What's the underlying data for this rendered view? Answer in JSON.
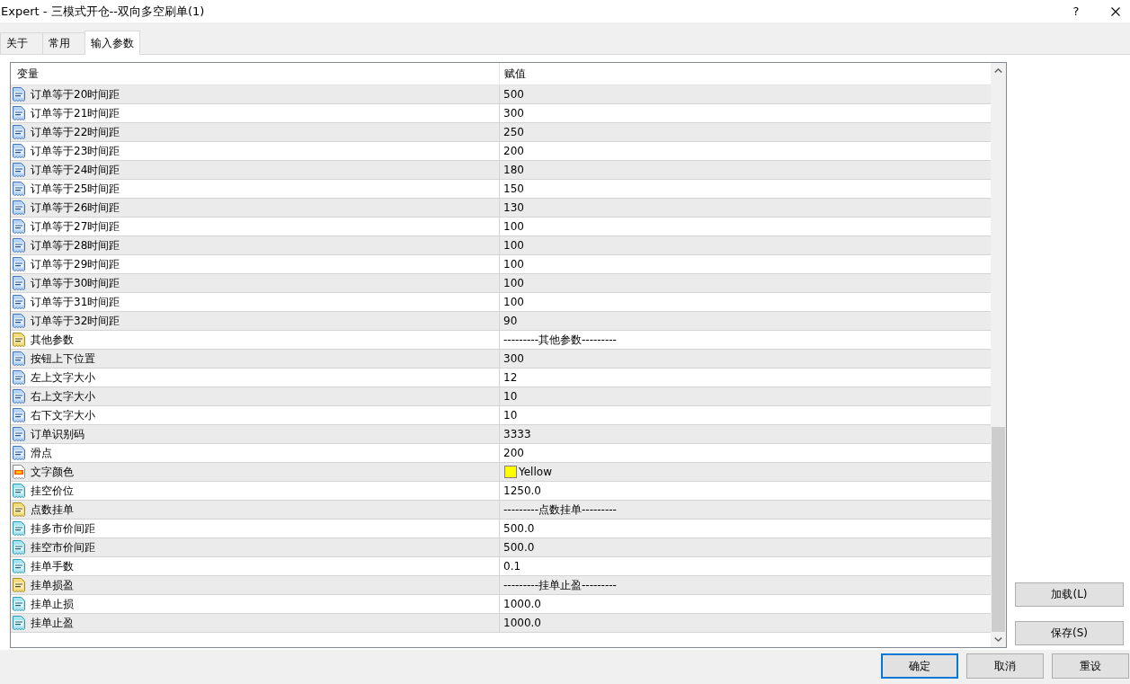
{
  "window": {
    "title": "Expert - 三模式开仓--双向多空刷单(1)",
    "help": "?"
  },
  "tabs": [
    {
      "label": "关于",
      "selected": false
    },
    {
      "label": "常用",
      "selected": false
    },
    {
      "label": "输入参数",
      "selected": true
    }
  ],
  "table": {
    "columns": [
      "变量",
      "赋值"
    ],
    "rows": [
      {
        "kind": "int",
        "name": "订单等于20时间距",
        "value": "500"
      },
      {
        "kind": "int",
        "name": "订单等于21时间距",
        "value": "300"
      },
      {
        "kind": "int",
        "name": "订单等于22时间距",
        "value": "250"
      },
      {
        "kind": "int",
        "name": "订单等于23时间距",
        "value": "200"
      },
      {
        "kind": "int",
        "name": "订单等于24时间距",
        "value": "180"
      },
      {
        "kind": "int",
        "name": "订单等于25时间距",
        "value": "150"
      },
      {
        "kind": "int",
        "name": "订单等于26时间距",
        "value": "130"
      },
      {
        "kind": "int",
        "name": "订单等于27时间距",
        "value": "100"
      },
      {
        "kind": "int",
        "name": "订单等于28时间距",
        "value": "100"
      },
      {
        "kind": "int",
        "name": "订单等于29时间距",
        "value": "100"
      },
      {
        "kind": "int",
        "name": "订单等于30时间距",
        "value": "100"
      },
      {
        "kind": "int",
        "name": "订单等于31时间距",
        "value": "100"
      },
      {
        "kind": "int",
        "name": "订单等于32时间距",
        "value": "90"
      },
      {
        "kind": "string",
        "name": "其他参数",
        "value": "---------其他参数---------"
      },
      {
        "kind": "int",
        "name": "按钮上下位置",
        "value": "300"
      },
      {
        "kind": "int",
        "name": "左上文字大小",
        "value": "12"
      },
      {
        "kind": "int",
        "name": "右上文字大小",
        "value": "10"
      },
      {
        "kind": "int",
        "name": "右下文字大小",
        "value": "10"
      },
      {
        "kind": "int",
        "name": "订单识别码",
        "value": "3333"
      },
      {
        "kind": "int",
        "name": "滑点",
        "value": "200"
      },
      {
        "kind": "color",
        "name": "文字颜色",
        "value": "Yellow",
        "color": "#ffff00"
      },
      {
        "kind": "double",
        "name": "挂空价位",
        "value": "1250.0"
      },
      {
        "kind": "string",
        "name": "点数挂单",
        "value": "---------点数挂单---------"
      },
      {
        "kind": "double",
        "name": "挂多市价间距",
        "value": "500.0"
      },
      {
        "kind": "double",
        "name": "挂空市价间距",
        "value": "500.0"
      },
      {
        "kind": "double",
        "name": "挂单手数",
        "value": "0.1"
      },
      {
        "kind": "string",
        "name": "挂单损盈",
        "value": "---------挂单止盈---------"
      },
      {
        "kind": "double",
        "name": "挂单止损",
        "value": "1000.0"
      },
      {
        "kind": "double",
        "name": "挂单止盈",
        "value": "1000.0"
      }
    ]
  },
  "side_buttons": [
    "加载(L)",
    "保存(S)"
  ],
  "buttons": [
    {
      "label": "确定",
      "focused": true
    },
    {
      "label": "取消",
      "focused": false
    },
    {
      "label": "重设",
      "focused": false
    }
  ]
}
